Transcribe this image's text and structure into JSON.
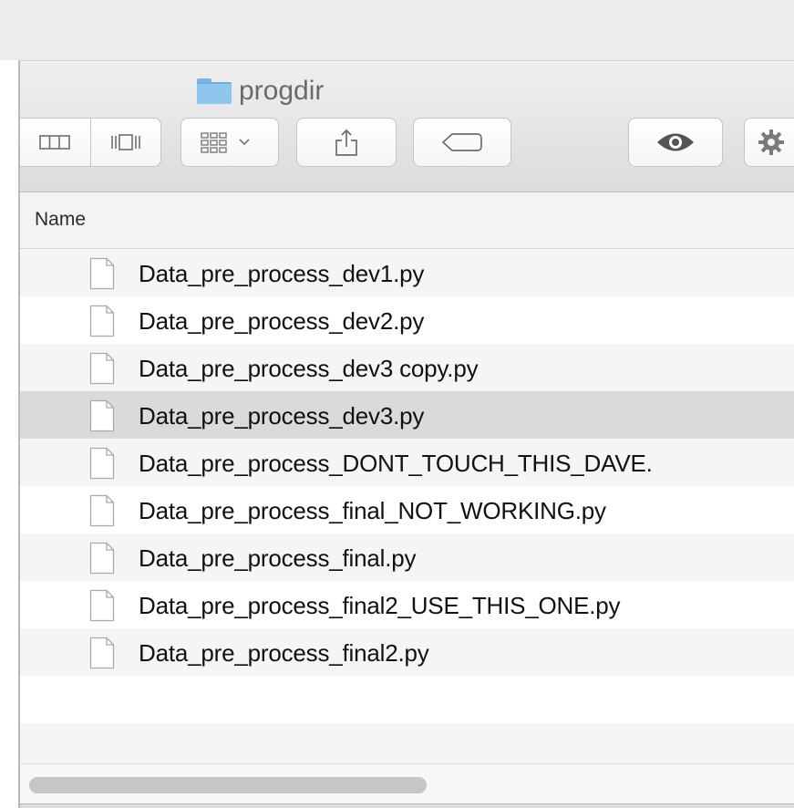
{
  "window": {
    "title": "progdir"
  },
  "toolbar": {
    "buttons": [
      {
        "name": "column-view",
        "icon": "columns-icon"
      },
      {
        "name": "cover-flow-view",
        "icon": "cover-flow-icon"
      },
      {
        "name": "arrange",
        "icon": "grid-arrange-icon"
      },
      {
        "name": "share",
        "icon": "share-icon"
      },
      {
        "name": "tags",
        "icon": "tag-icon"
      },
      {
        "name": "quick-look",
        "icon": "eye-icon"
      },
      {
        "name": "action",
        "icon": "gear-icon"
      }
    ]
  },
  "list": {
    "header": "Name",
    "selected_index": 3,
    "files": [
      "Data_pre_process_dev1.py",
      "Data_pre_process_dev2.py",
      "Data_pre_process_dev3 copy.py",
      "Data_pre_process_dev3.py",
      "Data_pre_process_DONT_TOUCH_THIS_DAVE.",
      "Data_pre_process_final_NOT_WORKING.py",
      "Data_pre_process_final.py",
      "Data_pre_process_final2_USE_THIS_ONE.py",
      "Data_pre_process_final2.py"
    ]
  },
  "colors": {
    "selection": "#dadada",
    "alternate_row": "#f4f5f5",
    "folder": "#8fc6ee"
  }
}
